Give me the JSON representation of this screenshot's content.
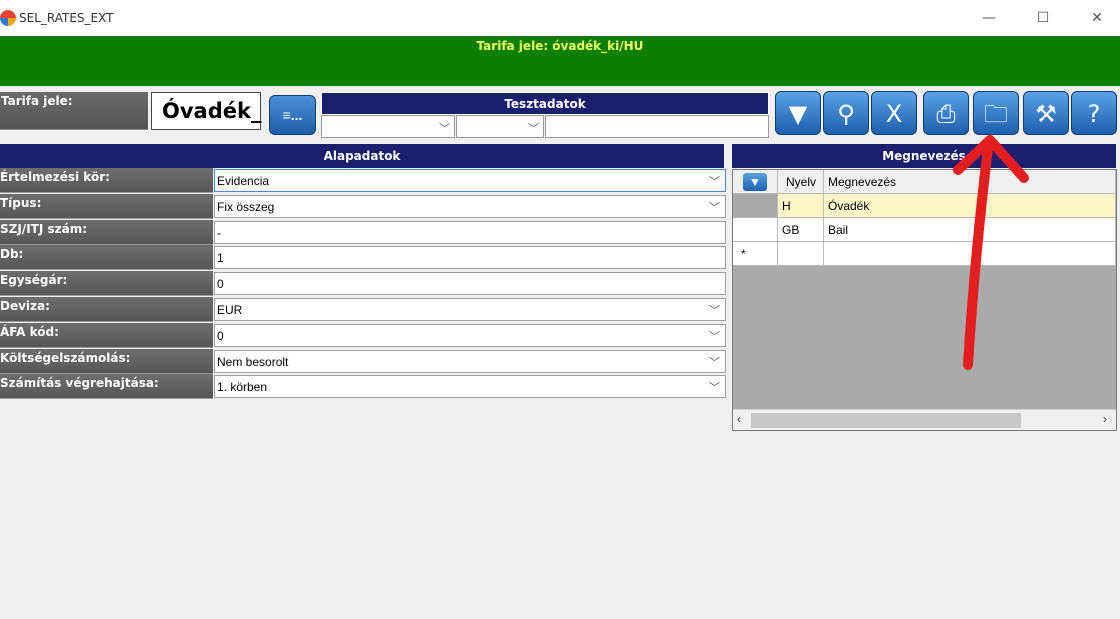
{
  "window": {
    "title": "SEL_RATES_EXT",
    "minimize": "—",
    "maximize": "☐",
    "close": "✕"
  },
  "banner": {
    "text": "Tarifa jele: óvadék_ki/HU"
  },
  "tarifa": {
    "label": "Tarifa jele:",
    "value": "Óvadék_",
    "button_label": "≡..."
  },
  "teszt": {
    "header": "Tesztadatok"
  },
  "toolbar": {
    "icons": [
      "filter-icon",
      "search-icon",
      "excel-export-icon",
      "printer-icon",
      "folder-open-icon",
      "tools-icon",
      "help-icon"
    ],
    "glyphs": [
      "▼",
      "⚲",
      "X",
      "⎙",
      "🗀",
      "⚒",
      "?"
    ]
  },
  "alapadatok": {
    "header": "Alapadatok",
    "rows": [
      {
        "label": "Értelmezési kör:",
        "value": "Evidencia",
        "dropdown": true
      },
      {
        "label": "Típus:",
        "value": "Fix összeg",
        "dropdown": true
      },
      {
        "label": "SZJ/ITJ szám:",
        "value": "-",
        "dropdown": false
      },
      {
        "label": "Db:",
        "value": "1",
        "dropdown": false
      },
      {
        "label": "Egységár:",
        "value": "0",
        "dropdown": false
      },
      {
        "label": "Deviza:",
        "value": "EUR",
        "dropdown": true
      },
      {
        "label": "ÁFA kód:",
        "value": "0",
        "dropdown": true
      },
      {
        "label": "Költségelszámolás:",
        "value": "Nem besorolt",
        "dropdown": true
      },
      {
        "label": "Számítás végrehajtása:",
        "value": "1. körben",
        "dropdown": true
      }
    ]
  },
  "megnevezes": {
    "header": "Megnevezés",
    "columns": [
      "Nyelv",
      "Megnevezés"
    ],
    "rows": [
      {
        "nyelv": "H",
        "megnevezes": "Óvadék"
      },
      {
        "nyelv": "GB",
        "megnevezes": "Bail"
      }
    ],
    "new_row_marker": "*"
  },
  "colors": {
    "banner_bg": "#0b8000",
    "banner_text": "#f0ff60",
    "header_bg": "#1a1f6e",
    "button_blue": "#1e5fae",
    "selected_row": "#fff6c8",
    "annotation_arrow": "#e41e1e"
  }
}
